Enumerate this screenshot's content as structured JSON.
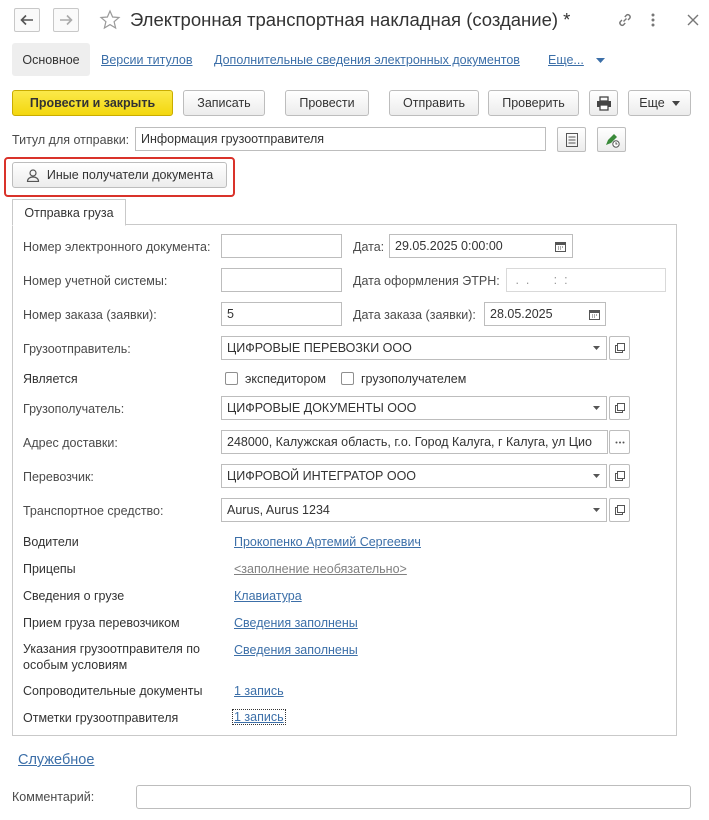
{
  "window": {
    "title": "Электронная транспортная накладная (создание) *"
  },
  "tabs": [
    {
      "label": "Основное"
    },
    {
      "label": "Версии титулов"
    },
    {
      "label": "Дополнительные сведения электронных документов"
    },
    {
      "label": "Еще..."
    }
  ],
  "toolbar": {
    "post_close": "Провести и закрыть",
    "save": "Записать",
    "post": "Провести",
    "send": "Отправить",
    "check": "Проверить",
    "more": "Еще"
  },
  "title_send": {
    "label": "Титул для отправки:",
    "value": "Информация грузоотправителя"
  },
  "other_recipients": "Иные получатели документа",
  "section_tab": "Отправка груза",
  "fields": {
    "doc_number_label": "Номер электронного документа:",
    "doc_number_value": "",
    "date_label": "Дата:",
    "date_value": "29.05.2025  0:00:00",
    "acc_number_label": "Номер учетной системы:",
    "acc_number_value": "",
    "etrn_date_label": "Дата оформления ЭТРН:",
    "etrn_date_value": " .  .       :  : ",
    "order_number_label": "Номер заказа (заявки):",
    "order_number_value": "5",
    "order_date_label": "Дата заказа (заявки):",
    "order_date_value": "28.05.2025",
    "shipper_label": "Грузоотправитель:",
    "shipper_value": "ЦИФРОВЫЕ ПЕРЕВОЗКИ ООО",
    "is_label": "Является",
    "forwarder_label": "экспедитором",
    "consignee_check_label": "грузополучателем",
    "consignee_label": "Грузополучатель:",
    "consignee_value": "ЦИФРОВЫЕ ДОКУМЕНТЫ ООО",
    "address_label": "Адрес доставки:",
    "address_value": "248000, Калужская область, г.о. Город Калуга, г Калуга, ул Цио",
    "carrier_label": "Перевозчик:",
    "carrier_value": "ЦИФРОВОЙ ИНТЕГРАТОР ООО",
    "vehicle_label": "Транспортное средство:",
    "vehicle_value": "Aurus, Aurus 1234",
    "drivers_label": "Водители",
    "drivers_value": "Прокопенко Артемий Сергеевич",
    "trailers_label": "Прицепы",
    "trailers_value": "<заполнение необязательно>",
    "cargo_label": "Сведения о грузе",
    "cargo_value": "Клавиатура",
    "acceptance_label": "Прием груза перевозчиком",
    "acceptance_value": "Сведения заполнены",
    "special_label_1": "Указания грузоотправителя по",
    "special_label_2": "особым условиям",
    "special_value": "Сведения заполнены",
    "docs_label": "Сопроводительные документы",
    "docs_value": "1 запись",
    "marks_label": "Отметки грузоотправителя",
    "marks_value": "1 запись"
  },
  "service_link": "Служебное",
  "comment": {
    "label": "Комментарий:",
    "value": ""
  },
  "colors": {
    "primary_button": "#f3d70e",
    "link": "#3c6fa8",
    "highlight": "#d9322a"
  },
  "icons": [
    "back-arrow-icon",
    "forward-arrow-icon",
    "star-icon",
    "link-icon",
    "kebab-icon",
    "maximize-icon",
    "close-icon",
    "print-icon",
    "list-icon",
    "edit-sign-icon",
    "person-icon",
    "calendar-icon",
    "dropdown-icon",
    "open-icon",
    "ellipsis-icon"
  ]
}
